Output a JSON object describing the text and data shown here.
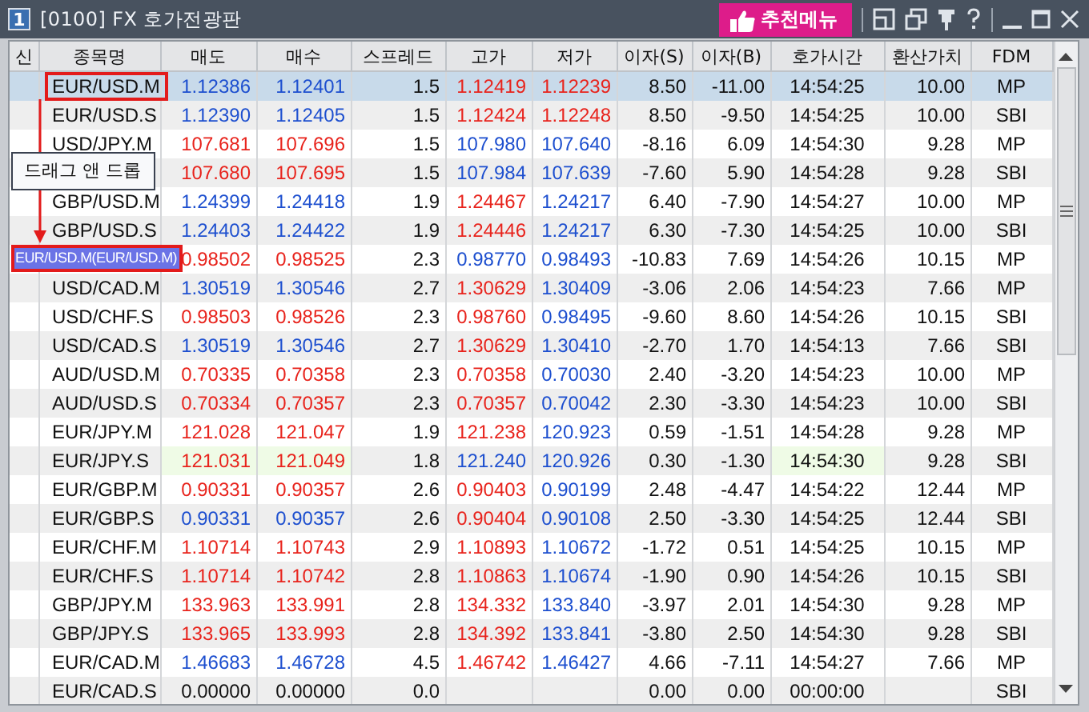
{
  "window": {
    "number": "1",
    "title": "[0100] FX 호가전광판",
    "menu_button": "추천메뉴"
  },
  "table": {
    "columns": [
      "신",
      "종목명",
      "매도",
      "매수",
      "스프레드",
      "고가",
      "저가",
      "이자(S)",
      "이자(B)",
      "호가시간",
      "환산가치",
      "FDM"
    ],
    "rows": [
      {
        "selected": true,
        "drag_source": true,
        "cells": [
          {
            "text": ""
          },
          {
            "text": "EUR/USD.M"
          },
          {
            "text": "1.12386",
            "color": "#1d4fcf"
          },
          {
            "text": "1.12401",
            "color": "#1d4fcf"
          },
          {
            "text": "1.5"
          },
          {
            "text": "1.12419",
            "color": "#e8231c"
          },
          {
            "text": "1.12239",
            "color": "#e8231c"
          },
          {
            "text": "8.50"
          },
          {
            "text": "-11.00"
          },
          {
            "text": "14:54:25"
          },
          {
            "text": "10.00"
          },
          {
            "text": "MP"
          }
        ]
      },
      {
        "selected": false,
        "cells": [
          {
            "text": ""
          },
          {
            "text": "EUR/USD.S"
          },
          {
            "text": "1.12390",
            "color": "#1d4fcf"
          },
          {
            "text": "1.12405",
            "color": "#1d4fcf"
          },
          {
            "text": "1.5"
          },
          {
            "text": "1.12424",
            "color": "#e8231c"
          },
          {
            "text": "1.12248",
            "color": "#e8231c"
          },
          {
            "text": "8.50"
          },
          {
            "text": "-9.50"
          },
          {
            "text": "14:54:25"
          },
          {
            "text": "10.00"
          },
          {
            "text": "SBI"
          }
        ]
      },
      {
        "selected": false,
        "cells": [
          {
            "text": ""
          },
          {
            "text": "USD/JPY.M"
          },
          {
            "text": "107.681",
            "color": "#e8231c"
          },
          {
            "text": "107.696",
            "color": "#e8231c"
          },
          {
            "text": "1.5"
          },
          {
            "text": "107.980",
            "color": "#1d4fcf"
          },
          {
            "text": "107.640",
            "color": "#1d4fcf"
          },
          {
            "text": "-8.16"
          },
          {
            "text": "6.09"
          },
          {
            "text": "14:54:30"
          },
          {
            "text": "9.28"
          },
          {
            "text": "MP"
          }
        ]
      },
      {
        "selected": false,
        "tooltip": "드래그 앤 드롭",
        "cells": [
          {
            "text": ""
          },
          {
            "text": ""
          },
          {
            "text": "107.680",
            "color": "#e8231c"
          },
          {
            "text": "107.695",
            "color": "#e8231c"
          },
          {
            "text": "1.5"
          },
          {
            "text": "107.984",
            "color": "#1d4fcf"
          },
          {
            "text": "107.639",
            "color": "#1d4fcf"
          },
          {
            "text": "-7.60"
          },
          {
            "text": "5.90"
          },
          {
            "text": "14:54:28"
          },
          {
            "text": "9.28"
          },
          {
            "text": "SBI"
          }
        ]
      },
      {
        "selected": false,
        "cells": [
          {
            "text": ""
          },
          {
            "text": "GBP/USD.M"
          },
          {
            "text": "1.24399",
            "color": "#1d4fcf"
          },
          {
            "text": "1.24418",
            "color": "#1d4fcf"
          },
          {
            "text": "1.9"
          },
          {
            "text": "1.24467",
            "color": "#e8231c"
          },
          {
            "text": "1.24217",
            "color": "#1d4fcf"
          },
          {
            "text": "6.40"
          },
          {
            "text": "-7.90"
          },
          {
            "text": "14:54:27"
          },
          {
            "text": "10.00"
          },
          {
            "text": "MP"
          }
        ]
      },
      {
        "selected": false,
        "cells": [
          {
            "text": ""
          },
          {
            "text": "GBP/USD.S"
          },
          {
            "text": "1.24403",
            "color": "#1d4fcf"
          },
          {
            "text": "1.24422",
            "color": "#1d4fcf"
          },
          {
            "text": "1.9"
          },
          {
            "text": "1.24446",
            "color": "#e8231c"
          },
          {
            "text": "1.24217",
            "color": "#1d4fcf"
          },
          {
            "text": "6.30"
          },
          {
            "text": "-7.30"
          },
          {
            "text": "14:54:25"
          },
          {
            "text": "10.00"
          },
          {
            "text": "SBI"
          }
        ]
      },
      {
        "selected": false,
        "drag_ghost": "EUR/USD.M(EUR/USD.M)",
        "cells": [
          {
            "text": ""
          },
          {
            "text": ""
          },
          {
            "text": "0.98502",
            "color": "#e8231c"
          },
          {
            "text": "0.98525",
            "color": "#e8231c"
          },
          {
            "text": "2.3"
          },
          {
            "text": "0.98770",
            "color": "#1d4fcf"
          },
          {
            "text": "0.98493",
            "color": "#1d4fcf"
          },
          {
            "text": "-10.83"
          },
          {
            "text": "7.69"
          },
          {
            "text": "14:54:26"
          },
          {
            "text": "10.15"
          },
          {
            "text": "MP"
          }
        ]
      },
      {
        "selected": false,
        "cells": [
          {
            "text": ""
          },
          {
            "text": "USD/CAD.M"
          },
          {
            "text": "1.30519",
            "color": "#1d4fcf"
          },
          {
            "text": "1.30546",
            "color": "#1d4fcf"
          },
          {
            "text": "2.7"
          },
          {
            "text": "1.30629",
            "color": "#e8231c"
          },
          {
            "text": "1.30409",
            "color": "#1d4fcf"
          },
          {
            "text": "-3.06"
          },
          {
            "text": "2.06"
          },
          {
            "text": "14:54:23"
          },
          {
            "text": "7.66"
          },
          {
            "text": "MP"
          }
        ]
      },
      {
        "selected": false,
        "cells": [
          {
            "text": ""
          },
          {
            "text": "USD/CHF.S"
          },
          {
            "text": "0.98503",
            "color": "#e8231c"
          },
          {
            "text": "0.98526",
            "color": "#e8231c"
          },
          {
            "text": "2.3"
          },
          {
            "text": "0.98760",
            "color": "#e8231c"
          },
          {
            "text": "0.98495",
            "color": "#1d4fcf"
          },
          {
            "text": "-9.60"
          },
          {
            "text": "8.60"
          },
          {
            "text": "14:54:26"
          },
          {
            "text": "10.15"
          },
          {
            "text": "SBI"
          }
        ]
      },
      {
        "selected": false,
        "cells": [
          {
            "text": ""
          },
          {
            "text": "USD/CAD.S"
          },
          {
            "text": "1.30519",
            "color": "#1d4fcf"
          },
          {
            "text": "1.30546",
            "color": "#1d4fcf"
          },
          {
            "text": "2.7"
          },
          {
            "text": "1.30629",
            "color": "#e8231c"
          },
          {
            "text": "1.30410",
            "color": "#1d4fcf"
          },
          {
            "text": "-2.70"
          },
          {
            "text": "1.70"
          },
          {
            "text": "14:54:13"
          },
          {
            "text": "7.66"
          },
          {
            "text": "SBI"
          }
        ]
      },
      {
        "selected": false,
        "cells": [
          {
            "text": ""
          },
          {
            "text": "AUD/USD.M"
          },
          {
            "text": "0.70335",
            "color": "#e8231c"
          },
          {
            "text": "0.70358",
            "color": "#e8231c"
          },
          {
            "text": "2.3"
          },
          {
            "text": "0.70358",
            "color": "#e8231c"
          },
          {
            "text": "0.70030",
            "color": "#1d4fcf"
          },
          {
            "text": "2.40"
          },
          {
            "text": "-3.20"
          },
          {
            "text": "14:54:23"
          },
          {
            "text": "10.00"
          },
          {
            "text": "MP"
          }
        ]
      },
      {
        "selected": false,
        "cells": [
          {
            "text": ""
          },
          {
            "text": "AUD/USD.S"
          },
          {
            "text": "0.70334",
            "color": "#e8231c"
          },
          {
            "text": "0.70357",
            "color": "#e8231c"
          },
          {
            "text": "2.3"
          },
          {
            "text": "0.70357",
            "color": "#e8231c"
          },
          {
            "text": "0.70042",
            "color": "#1d4fcf"
          },
          {
            "text": "2.30"
          },
          {
            "text": "-3.30"
          },
          {
            "text": "14:54:23"
          },
          {
            "text": "10.00"
          },
          {
            "text": "SBI"
          }
        ]
      },
      {
        "selected": false,
        "cells": [
          {
            "text": ""
          },
          {
            "text": "EUR/JPY.M"
          },
          {
            "text": "121.028",
            "color": "#e8231c"
          },
          {
            "text": "121.047",
            "color": "#e8231c"
          },
          {
            "text": "1.9"
          },
          {
            "text": "121.238",
            "color": "#e8231c"
          },
          {
            "text": "120.923",
            "color": "#1d4fcf"
          },
          {
            "text": "0.59"
          },
          {
            "text": "-1.51"
          },
          {
            "text": "14:54:28"
          },
          {
            "text": "9.28"
          },
          {
            "text": "MP"
          }
        ]
      },
      {
        "selected": false,
        "cells": [
          {
            "text": ""
          },
          {
            "text": "EUR/JPY.S"
          },
          {
            "text": "121.031",
            "color": "#e8231c",
            "flash": true
          },
          {
            "text": "121.049",
            "color": "#e8231c",
            "flash": true
          },
          {
            "text": "1.8"
          },
          {
            "text": "121.240",
            "color": "#1d4fcf"
          },
          {
            "text": "120.926",
            "color": "#1d4fcf"
          },
          {
            "text": "0.30"
          },
          {
            "text": "-1.30"
          },
          {
            "text": "14:54:30",
            "flash": true
          },
          {
            "text": "9.28"
          },
          {
            "text": "SBI"
          }
        ]
      },
      {
        "selected": false,
        "cells": [
          {
            "text": ""
          },
          {
            "text": "EUR/GBP.M"
          },
          {
            "text": "0.90331",
            "color": "#e8231c"
          },
          {
            "text": "0.90357",
            "color": "#e8231c"
          },
          {
            "text": "2.6"
          },
          {
            "text": "0.90403",
            "color": "#e8231c"
          },
          {
            "text": "0.90199",
            "color": "#1d4fcf"
          },
          {
            "text": "2.48"
          },
          {
            "text": "-4.47"
          },
          {
            "text": "14:54:22"
          },
          {
            "text": "12.44"
          },
          {
            "text": "MP"
          }
        ]
      },
      {
        "selected": false,
        "cells": [
          {
            "text": ""
          },
          {
            "text": "EUR/GBP.S"
          },
          {
            "text": "0.90331",
            "color": "#1d4fcf"
          },
          {
            "text": "0.90357",
            "color": "#1d4fcf"
          },
          {
            "text": "2.6"
          },
          {
            "text": "0.90404",
            "color": "#e8231c"
          },
          {
            "text": "0.90108",
            "color": "#1d4fcf"
          },
          {
            "text": "2.50"
          },
          {
            "text": "-3.30"
          },
          {
            "text": "14:54:25"
          },
          {
            "text": "12.44"
          },
          {
            "text": "SBI"
          }
        ]
      },
      {
        "selected": false,
        "cells": [
          {
            "text": ""
          },
          {
            "text": "EUR/CHF.M"
          },
          {
            "text": "1.10714",
            "color": "#e8231c"
          },
          {
            "text": "1.10743",
            "color": "#e8231c"
          },
          {
            "text": "2.9"
          },
          {
            "text": "1.10893",
            "color": "#e8231c"
          },
          {
            "text": "1.10672",
            "color": "#1d4fcf"
          },
          {
            "text": "-1.72"
          },
          {
            "text": "0.51"
          },
          {
            "text": "14:54:25"
          },
          {
            "text": "10.15"
          },
          {
            "text": "MP"
          }
        ]
      },
      {
        "selected": false,
        "cells": [
          {
            "text": ""
          },
          {
            "text": "EUR/CHF.S"
          },
          {
            "text": "1.10714",
            "color": "#e8231c"
          },
          {
            "text": "1.10742",
            "color": "#e8231c"
          },
          {
            "text": "2.8"
          },
          {
            "text": "1.10863",
            "color": "#e8231c"
          },
          {
            "text": "1.10674",
            "color": "#1d4fcf"
          },
          {
            "text": "-1.90"
          },
          {
            "text": "0.90"
          },
          {
            "text": "14:54:26"
          },
          {
            "text": "10.15"
          },
          {
            "text": "SBI"
          }
        ]
      },
      {
        "selected": false,
        "cells": [
          {
            "text": ""
          },
          {
            "text": "GBP/JPY.M"
          },
          {
            "text": "133.963",
            "color": "#e8231c"
          },
          {
            "text": "133.991",
            "color": "#e8231c"
          },
          {
            "text": "2.8"
          },
          {
            "text": "134.332",
            "color": "#e8231c"
          },
          {
            "text": "133.840",
            "color": "#1d4fcf"
          },
          {
            "text": "-3.97"
          },
          {
            "text": "2.01"
          },
          {
            "text": "14:54:30"
          },
          {
            "text": "9.28"
          },
          {
            "text": "MP"
          }
        ]
      },
      {
        "selected": false,
        "cells": [
          {
            "text": ""
          },
          {
            "text": "GBP/JPY.S"
          },
          {
            "text": "133.965",
            "color": "#e8231c"
          },
          {
            "text": "133.993",
            "color": "#e8231c"
          },
          {
            "text": "2.8"
          },
          {
            "text": "134.392",
            "color": "#e8231c"
          },
          {
            "text": "133.841",
            "color": "#1d4fcf"
          },
          {
            "text": "-3.80"
          },
          {
            "text": "2.50"
          },
          {
            "text": "14:54:30"
          },
          {
            "text": "9.28"
          },
          {
            "text": "SBI"
          }
        ]
      },
      {
        "selected": false,
        "cells": [
          {
            "text": ""
          },
          {
            "text": "EUR/CAD.M"
          },
          {
            "text": "1.46683",
            "color": "#1d4fcf"
          },
          {
            "text": "1.46728",
            "color": "#1d4fcf"
          },
          {
            "text": "4.5"
          },
          {
            "text": "1.46742",
            "color": "#e8231c"
          },
          {
            "text": "1.46427",
            "color": "#1d4fcf"
          },
          {
            "text": "4.66"
          },
          {
            "text": "-7.11"
          },
          {
            "text": "14:54:27"
          },
          {
            "text": "7.66"
          },
          {
            "text": "MP"
          }
        ]
      },
      {
        "selected": false,
        "cells": [
          {
            "text": ""
          },
          {
            "text": "EUR/CAD.S"
          },
          {
            "text": "0.00000"
          },
          {
            "text": "0.00000"
          },
          {
            "text": "0.0"
          },
          {
            "text": ""
          },
          {
            "text": ""
          },
          {
            "text": "0.00"
          },
          {
            "text": "0.00"
          },
          {
            "text": "00:00:00"
          },
          {
            "text": ""
          },
          {
            "text": "SBI"
          }
        ]
      }
    ]
  }
}
